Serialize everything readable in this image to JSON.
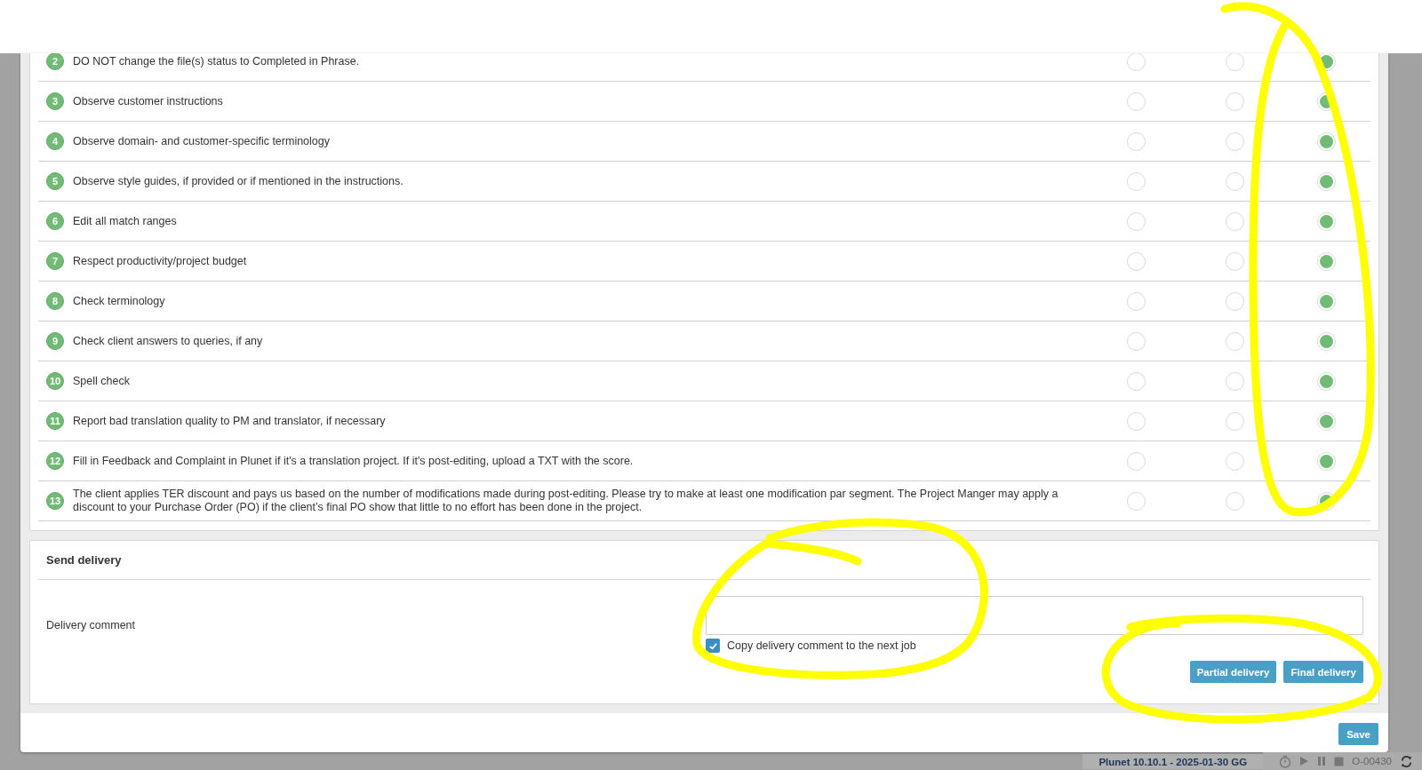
{
  "checklist": {
    "items": [
      {
        "number": "2",
        "text": "DO NOT change the file(s) status to Completed in Phrase.",
        "options": [
          {
            "selected": false
          },
          {
            "selected": false
          },
          {
            "selected": true
          }
        ]
      },
      {
        "number": "3",
        "text": "Observe customer instructions",
        "options": [
          {
            "selected": false
          },
          {
            "selected": false
          },
          {
            "selected": true
          }
        ]
      },
      {
        "number": "4",
        "text": "Observe domain- and customer-specific terminology",
        "options": [
          {
            "selected": false
          },
          {
            "selected": false
          },
          {
            "selected": true
          }
        ]
      },
      {
        "number": "5",
        "text": "Observe style guides, if provided or if mentioned in the instructions.",
        "options": [
          {
            "selected": false
          },
          {
            "selected": false
          },
          {
            "selected": true
          }
        ]
      },
      {
        "number": "6",
        "text": "Edit all match ranges",
        "options": [
          {
            "selected": false
          },
          {
            "selected": false
          },
          {
            "selected": true
          }
        ]
      },
      {
        "number": "7",
        "text": "Respect productivity/project budget",
        "options": [
          {
            "selected": false
          },
          {
            "selected": false
          },
          {
            "selected": true
          }
        ]
      },
      {
        "number": "8",
        "text": "Check terminology",
        "options": [
          {
            "selected": false
          },
          {
            "selected": false
          },
          {
            "selected": true
          }
        ]
      },
      {
        "number": "9",
        "text": "Check client answers to queries, if any",
        "options": [
          {
            "selected": false
          },
          {
            "selected": false
          },
          {
            "selected": true
          }
        ]
      },
      {
        "number": "10",
        "text": "Spell check",
        "options": [
          {
            "selected": false
          },
          {
            "selected": false
          },
          {
            "selected": true
          }
        ]
      },
      {
        "number": "11",
        "text": "Report bad translation quality to PM and translator, if necessary",
        "options": [
          {
            "selected": false
          },
          {
            "selected": false
          },
          {
            "selected": true
          }
        ]
      },
      {
        "number": "12",
        "text": "Fill in Feedback and Complaint in Plunet if it's a translation project. If it's post-editing, upload a TXT with the score.",
        "options": [
          {
            "selected": false
          },
          {
            "selected": false
          },
          {
            "selected": true
          }
        ]
      },
      {
        "number": "13",
        "text": "The client applies TER discount and pays us based on the number of modifications made during post-editing. Please try to make at least one modification par segment. The Project Manger may apply a discount to your Purchase Order (PO) if the client’s final PO show that little to no effort has been done in the project.",
        "options": [
          {
            "selected": false
          },
          {
            "selected": false
          },
          {
            "selected": true
          }
        ]
      }
    ]
  },
  "send_delivery": {
    "title": "Send delivery",
    "comment_label": "Delivery comment",
    "copy_comment": {
      "label": "Copy delivery comment to the next job",
      "checked": true
    },
    "buttons": [
      "Partial delivery",
      "Final delivery"
    ]
  },
  "footer": {
    "save_button": "Save"
  },
  "status_bar": {
    "version": "Plunet 10.10.1 - 2025-01-30 GG",
    "job_id": "O-00430"
  },
  "highlights": [
    {
      "kind": "tall-loop"
    },
    {
      "kind": "open-loop"
    },
    {
      "kind": "loop"
    }
  ]
}
